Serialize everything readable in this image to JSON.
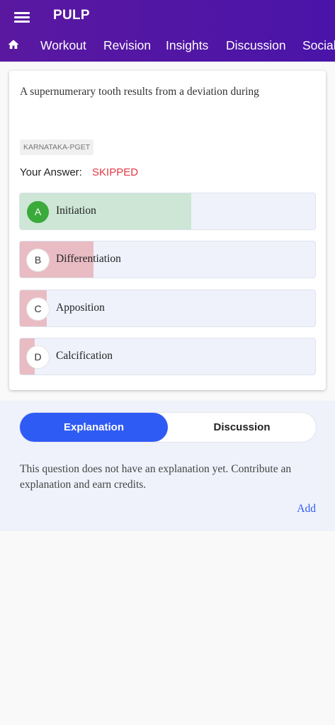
{
  "app": {
    "title": "PULP"
  },
  "nav": {
    "tabs": [
      "Workout",
      "Revision",
      "Insights",
      "Discussion",
      "Social"
    ]
  },
  "question": {
    "text": "A supernumerary tooth results from a deviation during",
    "tag": "KARNATAKA-PGET",
    "answer_label": "Your Answer:",
    "answer_value": "SKIPPED",
    "options": [
      {
        "letter": "A",
        "text": "Initiation",
        "percent": 58,
        "correct": true
      },
      {
        "letter": "B",
        "text": "Differentiation",
        "percent": 25,
        "correct": false
      },
      {
        "letter": "C",
        "text": "Apposition",
        "percent": 9,
        "correct": false
      },
      {
        "letter": "D",
        "text": "Calcification",
        "percent": 5,
        "correct": false
      }
    ]
  },
  "tabs": {
    "explanation": "Explanation",
    "discussion": "Discussion"
  },
  "explanation": {
    "text": "This question does not have an explanation yet. Contribute an explanation and earn credits.",
    "add_label": "Add"
  },
  "colors": {
    "header": "#5a18a0",
    "accent": "#2f5bf5",
    "correct": "#cde6d5",
    "wrong": "#e9bcc3",
    "skipped": "#e23744"
  }
}
